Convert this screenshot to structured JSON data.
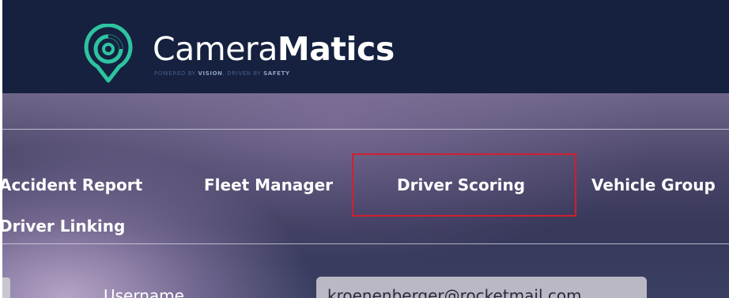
{
  "brand": {
    "name_light": "Camera",
    "name_bold": "Matics",
    "tagline_1": "POWERED BY ",
    "tagline_2": "VISION",
    "tagline_3": ", DRIVEN BY ",
    "tagline_4": "SAFETY",
    "logo_icon": "camera-lens-location-pin-icon"
  },
  "nav": {
    "items": [
      {
        "label": "Accident Report"
      },
      {
        "label": "Fleet Manager"
      },
      {
        "label": "Driver Scoring",
        "highlighted": true
      },
      {
        "label": "Vehicle Group"
      },
      {
        "label": "Driver Linking"
      }
    ]
  },
  "form": {
    "username_label": "Username",
    "username_value": "kroenenberger@rocketmail.com"
  },
  "colors": {
    "header_bg": "#15213f",
    "logo_accent": "#2ec4a0",
    "highlight_border": "#d0202e"
  }
}
